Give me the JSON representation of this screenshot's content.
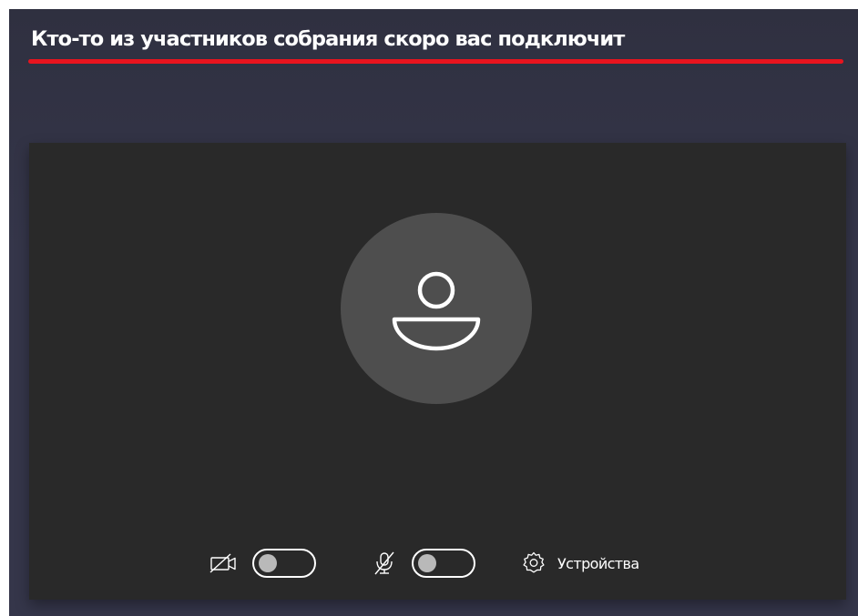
{
  "heading": {
    "text": "Кто-то из участников собрания скоро вас подключит"
  },
  "preview": {
    "avatar_icon": "person-icon"
  },
  "controls": {
    "camera": {
      "icon": "camera-off-icon",
      "state": "off"
    },
    "microphone": {
      "icon": "mic-off-icon",
      "state": "off"
    },
    "devices": {
      "icon": "gear-icon",
      "label": "Устройства"
    }
  },
  "colors": {
    "background": "#35364a",
    "preview": "#292929",
    "avatar": "#4e4e4e",
    "underline": "#e8141e",
    "text": "#ffffff",
    "knob": "#b9b9b9"
  }
}
